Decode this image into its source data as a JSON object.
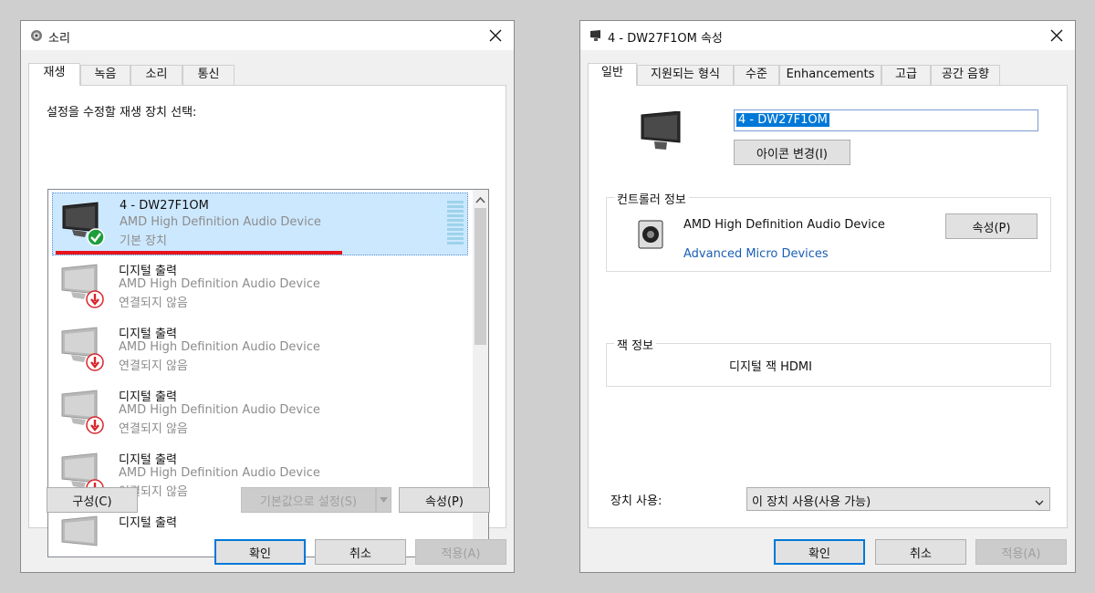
{
  "left_dialog": {
    "title": "소리",
    "tabs": [
      "재생",
      "녹음",
      "소리",
      "통신"
    ],
    "instruction": "설정을 수정할 재생 장치 선택:",
    "devices": [
      {
        "name": "4 - DW27F1OM",
        "driver": "AMD High Definition Audio Device",
        "state": "기본 장치",
        "selected": true
      },
      {
        "name": "디지털 출력",
        "driver": "AMD High Definition Audio Device",
        "state": "연결되지 않음",
        "selected": false
      },
      {
        "name": "디지털 출력",
        "driver": "AMD High Definition Audio Device",
        "state": "연결되지 않음",
        "selected": false
      },
      {
        "name": "디지털 출력",
        "driver": "AMD High Definition Audio Device",
        "state": "연결되지 않음",
        "selected": false
      },
      {
        "name": "디지털 출력",
        "driver": "AMD High Definition Audio Device",
        "state": "연결되지 않음",
        "selected": false
      },
      {
        "name": "디지털 출력",
        "driver": "",
        "state": "",
        "selected": false
      }
    ],
    "buttons": {
      "configure": "구성(C)",
      "set_default": "기본값으로 설정(S)",
      "properties": "속성(P)",
      "ok": "확인",
      "cancel": "취소",
      "apply": "적용(A)"
    },
    "colors": {
      "selection": "#cce8ff",
      "annotation_underline": "#e8141c",
      "check_badge": "#1e9e3a",
      "unplugged_badge": "#d8262c"
    }
  },
  "right_dialog": {
    "title": "4 - DW27F1OM 속성",
    "tabs": [
      "일반",
      "지원되는 형식",
      "수준",
      "Enhancements",
      "고급",
      "공간 음향"
    ],
    "device_name_value": "4 - DW27F1OM",
    "change_icon_button": "아이콘 변경(I)",
    "controller_group": {
      "label": "컨트롤러 정보",
      "device": "AMD High Definition Audio Device",
      "vendor": "Advanced Micro Devices",
      "properties_button": "속성(P)"
    },
    "jack_group": {
      "label": "잭 정보",
      "jack": "디지털 잭 HDMI"
    },
    "device_usage": {
      "label": "장치 사용:",
      "value": "이 장치 사용(사용 가능)"
    },
    "buttons": {
      "ok": "확인",
      "cancel": "취소",
      "apply": "적용(A)"
    },
    "colors": {
      "vendor_link": "#1a5fb4",
      "accent": "#0078d7"
    }
  }
}
